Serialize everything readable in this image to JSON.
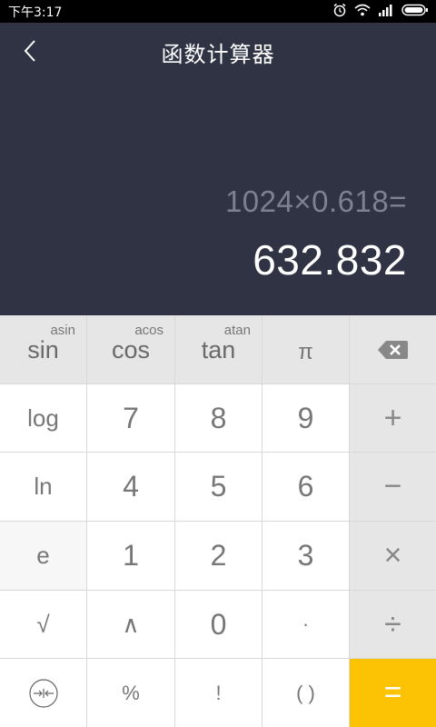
{
  "status": {
    "time": "下午3:17"
  },
  "header": {
    "title": "函数计算器"
  },
  "display": {
    "expression": "1024×0.618=",
    "result": "632.832"
  },
  "keys": {
    "sin": "sin",
    "asin": "asin",
    "cos": "cos",
    "acos": "acos",
    "tan": "tan",
    "atan": "atan",
    "pi": "π",
    "log": "log",
    "ln": "ln",
    "e": "e",
    "sqrt": "√",
    "seven": "7",
    "eight": "8",
    "nine": "9",
    "four": "4",
    "five": "5",
    "six": "6",
    "one": "1",
    "two": "2",
    "three": "3",
    "caret": "∧",
    "zero": "0",
    "dot": "·",
    "percent": "%",
    "fact": "!",
    "paren": "( )",
    "plus": "+",
    "minus": "−",
    "times": "×",
    "divide": "÷",
    "equals": "="
  },
  "colors": {
    "header_bg": "#2f3344",
    "equals_bg": "#fbc304"
  }
}
